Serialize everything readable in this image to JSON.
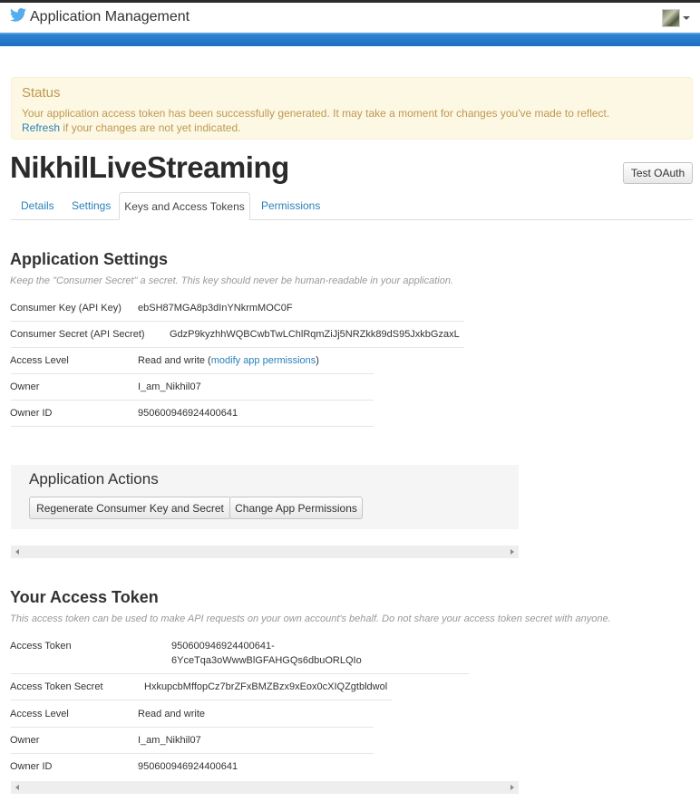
{
  "header": {
    "app_title": "Application Management",
    "brand_color": "#1da1f2",
    "logo_icon": "twitter-bird-icon",
    "account_icon": "user-avatar"
  },
  "status_alert": {
    "title": "Status",
    "message": "Your application access token has been successfully generated. It may take a moment for changes you've made to reflect.",
    "refresh_link": "Refresh",
    "refresh_suffix": " if your changes are not yet indicated."
  },
  "app": {
    "name": "NikhilLiveStreaming",
    "test_oauth_label": "Test OAuth"
  },
  "tabs": [
    {
      "label": "Details",
      "active": false
    },
    {
      "label": "Settings",
      "active": false
    },
    {
      "label": "Keys and Access Tokens",
      "active": true
    },
    {
      "label": "Permissions",
      "active": false
    }
  ],
  "application_settings": {
    "heading": "Application Settings",
    "note": "Keep the \"Consumer Secret\" a secret. This key should never be human-readable in your application.",
    "rows": [
      {
        "label": "Consumer Key (API Key)",
        "value": "ebSH87MGA8p3dInYNkrmMOC0F"
      },
      {
        "label": "Consumer Secret (API Secret)",
        "value": "GdzP9kyzhhWQBCwbTwLChlRqmZiJj5NRZkk89dS95JxkbGzaxL"
      },
      {
        "label": "Access Level",
        "value": "Read and write",
        "link_open": " (",
        "link": "modify app permissions",
        "link_close": ")"
      },
      {
        "label": "Owner",
        "value": "I_am_Nikhil07"
      },
      {
        "label": "Owner ID",
        "value": "950600946924400641"
      }
    ]
  },
  "application_actions": {
    "heading": "Application Actions",
    "regenerate_label": "Regenerate Consumer Key and Secret",
    "change_permissions_label": "Change App Permissions"
  },
  "access_token": {
    "heading": "Your Access Token",
    "note": "This access token can be used to make API requests on your own account's behalf. Do not share your access token secret with anyone.",
    "rows": [
      {
        "label": "Access Token",
        "value_line1": "950600946924400641-",
        "value_line2": "6YceTqa3oWwwBlGFAHGQs6dbuORLQIo"
      },
      {
        "label": "Access Token Secret",
        "value": "HxkupcbMffopCz7brZFxBMZBzx9xEox0cXIQZgtbldwol"
      },
      {
        "label": "Access Level",
        "value": "Read and write"
      },
      {
        "label": "Owner",
        "value": "I_am_Nikhil07"
      },
      {
        "label": "Owner ID",
        "value": "950600946924400641"
      }
    ]
  }
}
